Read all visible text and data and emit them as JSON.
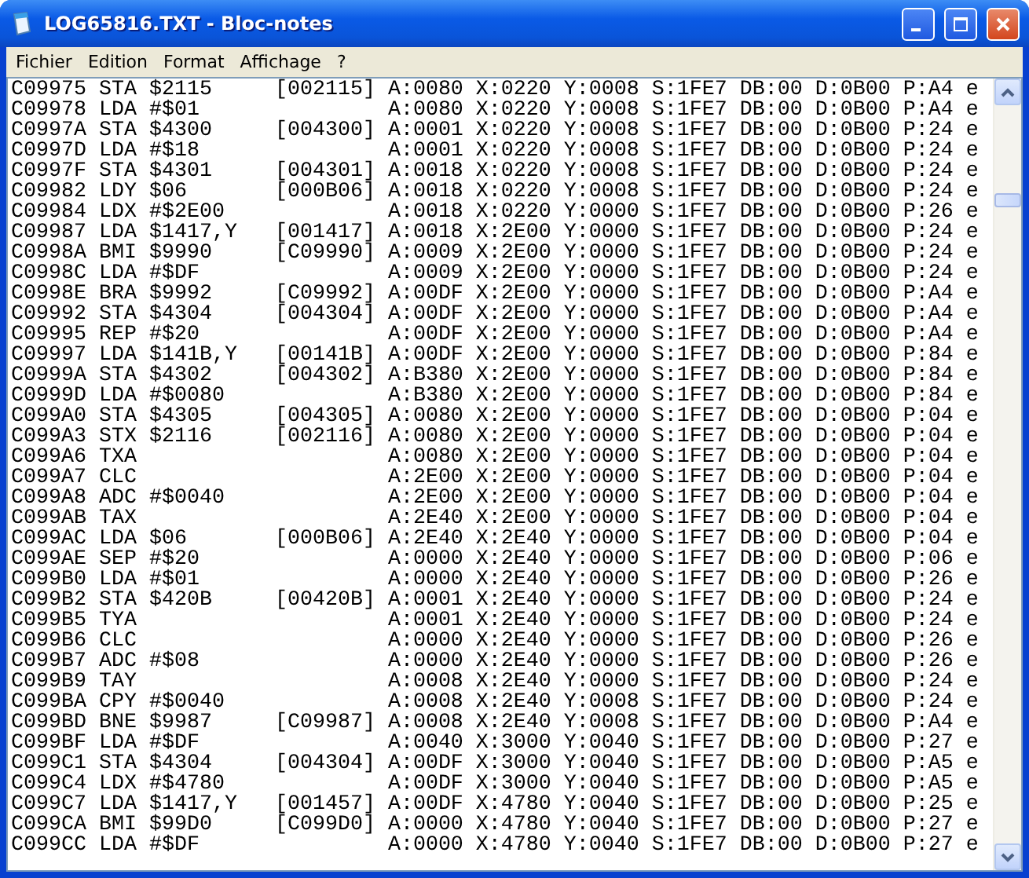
{
  "window": {
    "title": "LOG65816.TXT - Bloc-notes"
  },
  "menu": [
    {
      "label": "Fichier"
    },
    {
      "label": "Edition"
    },
    {
      "label": "Format"
    },
    {
      "label": "Affichage"
    },
    {
      "label": "?"
    }
  ],
  "lines": [
    "C09975 STA $2115     [002115] A:0080 X:0220 Y:0008 S:1FE7 DB:00 D:0B00 P:A4 e",
    "C09978 LDA #$01               A:0080 X:0220 Y:0008 S:1FE7 DB:00 D:0B00 P:A4 e",
    "C0997A STA $4300     [004300] A:0001 X:0220 Y:0008 S:1FE7 DB:00 D:0B00 P:24 e",
    "C0997D LDA #$18               A:0001 X:0220 Y:0008 S:1FE7 DB:00 D:0B00 P:24 e",
    "C0997F STA $4301     [004301] A:0018 X:0220 Y:0008 S:1FE7 DB:00 D:0B00 P:24 e",
    "C09982 LDY $06       [000B06] A:0018 X:0220 Y:0008 S:1FE7 DB:00 D:0B00 P:24 e",
    "C09984 LDX #$2E00             A:0018 X:0220 Y:0000 S:1FE7 DB:00 D:0B00 P:26 e",
    "C09987 LDA $1417,Y   [001417] A:0018 X:2E00 Y:0000 S:1FE7 DB:00 D:0B00 P:24 e",
    "C0998A BMI $9990     [C09990] A:0009 X:2E00 Y:0000 S:1FE7 DB:00 D:0B00 P:24 e",
    "C0998C LDA #$DF               A:0009 X:2E00 Y:0000 S:1FE7 DB:00 D:0B00 P:24 e",
    "C0998E BRA $9992     [C09992] A:00DF X:2E00 Y:0000 S:1FE7 DB:00 D:0B00 P:A4 e",
    "C09992 STA $4304     [004304] A:00DF X:2E00 Y:0000 S:1FE7 DB:00 D:0B00 P:A4 e",
    "C09995 REP #$20               A:00DF X:2E00 Y:0000 S:1FE7 DB:00 D:0B00 P:A4 e",
    "C09997 LDA $141B,Y   [00141B] A:00DF X:2E00 Y:0000 S:1FE7 DB:00 D:0B00 P:84 e",
    "C0999A STA $4302     [004302] A:B380 X:2E00 Y:0000 S:1FE7 DB:00 D:0B00 P:84 e",
    "C0999D LDA #$0080             A:B380 X:2E00 Y:0000 S:1FE7 DB:00 D:0B00 P:84 e",
    "C099A0 STA $4305     [004305] A:0080 X:2E00 Y:0000 S:1FE7 DB:00 D:0B00 P:04 e",
    "C099A3 STX $2116     [002116] A:0080 X:2E00 Y:0000 S:1FE7 DB:00 D:0B00 P:04 e",
    "C099A6 TXA                    A:0080 X:2E00 Y:0000 S:1FE7 DB:00 D:0B00 P:04 e",
    "C099A7 CLC                    A:2E00 X:2E00 Y:0000 S:1FE7 DB:00 D:0B00 P:04 e",
    "C099A8 ADC #$0040             A:2E00 X:2E00 Y:0000 S:1FE7 DB:00 D:0B00 P:04 e",
    "C099AB TAX                    A:2E40 X:2E00 Y:0000 S:1FE7 DB:00 D:0B00 P:04 e",
    "C099AC LDA $06       [000B06] A:2E40 X:2E40 Y:0000 S:1FE7 DB:00 D:0B00 P:04 e",
    "C099AE SEP #$20               A:0000 X:2E40 Y:0000 S:1FE7 DB:00 D:0B00 P:06 e",
    "C099B0 LDA #$01               A:0000 X:2E40 Y:0000 S:1FE7 DB:00 D:0B00 P:26 e",
    "C099B2 STA $420B     [00420B] A:0001 X:2E40 Y:0000 S:1FE7 DB:00 D:0B00 P:24 e",
    "C099B5 TYA                    A:0001 X:2E40 Y:0000 S:1FE7 DB:00 D:0B00 P:24 e",
    "C099B6 CLC                    A:0000 X:2E40 Y:0000 S:1FE7 DB:00 D:0B00 P:26 e",
    "C099B7 ADC #$08               A:0000 X:2E40 Y:0000 S:1FE7 DB:00 D:0B00 P:26 e",
    "C099B9 TAY                    A:0008 X:2E40 Y:0000 S:1FE7 DB:00 D:0B00 P:24 e",
    "C099BA CPY #$0040             A:0008 X:2E40 Y:0008 S:1FE7 DB:00 D:0B00 P:24 e",
    "C099BD BNE $9987     [C09987] A:0008 X:2E40 Y:0008 S:1FE7 DB:00 D:0B00 P:A4 e",
    "C099BF LDA #$DF               A:0040 X:3000 Y:0040 S:1FE7 DB:00 D:0B00 P:27 e",
    "C099C1 STA $4304     [004304] A:00DF X:3000 Y:0040 S:1FE7 DB:00 D:0B00 P:A5 e",
    "C099C4 LDX #$4780             A:00DF X:3000 Y:0040 S:1FE7 DB:00 D:0B00 P:A5 e",
    "C099C7 LDA $1417,Y   [001457] A:00DF X:4780 Y:0040 S:1FE7 DB:00 D:0B00 P:25 e",
    "C099CA BMI $99D0     [C099D0] A:0000 X:4780 Y:0040 S:1FE7 DB:00 D:0B00 P:27 e",
    "C099CC LDA #$DF               A:0000 X:4780 Y:0040 S:1FE7 DB:00 D:0B00 P:27 e"
  ]
}
